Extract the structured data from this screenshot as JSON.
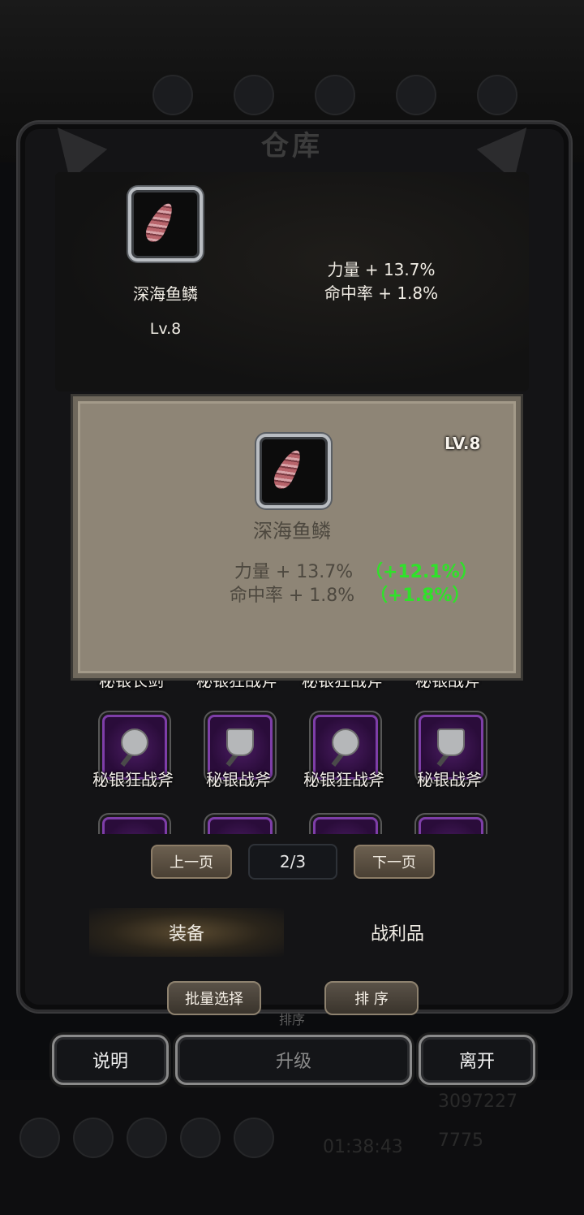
{
  "window": {
    "title": "仓库"
  },
  "selected_item": {
    "name": "深海鱼鳞",
    "level": "Lv.8",
    "stats": [
      "力量 + 13.7%",
      "命中率 + 1.8%"
    ]
  },
  "detail_panel": {
    "level": "LV.8",
    "name": "深海鱼鳞",
    "stats": [
      {
        "text": "力量 + 13.7%",
        "bonus": "（+12.1%）"
      },
      {
        "text": "命中率 + 1.8%",
        "bonus": "（+1.8%）"
      }
    ]
  },
  "grid": {
    "partial_row_labels": [
      "秘银长剑",
      "秘银狂战斧",
      "秘银狂战斧",
      "秘银战斧"
    ],
    "row_labels": [
      "秘银狂战斧",
      "秘银战斧",
      "秘银狂战斧",
      "秘银战斧"
    ]
  },
  "pager": {
    "prev": "上一页",
    "page": "2/3",
    "next": "下一页"
  },
  "tabs": {
    "equipment": "装备",
    "loot": "战利品"
  },
  "actions": {
    "batch_select": "批量选择",
    "sort": "排 序",
    "sort_shadow": "排序"
  },
  "bottom": {
    "help": "说明",
    "upgrade": "升级",
    "leave": "离开"
  },
  "background": {
    "timer": "01:38:43",
    "gold": "3097227",
    "gems": "7775"
  }
}
